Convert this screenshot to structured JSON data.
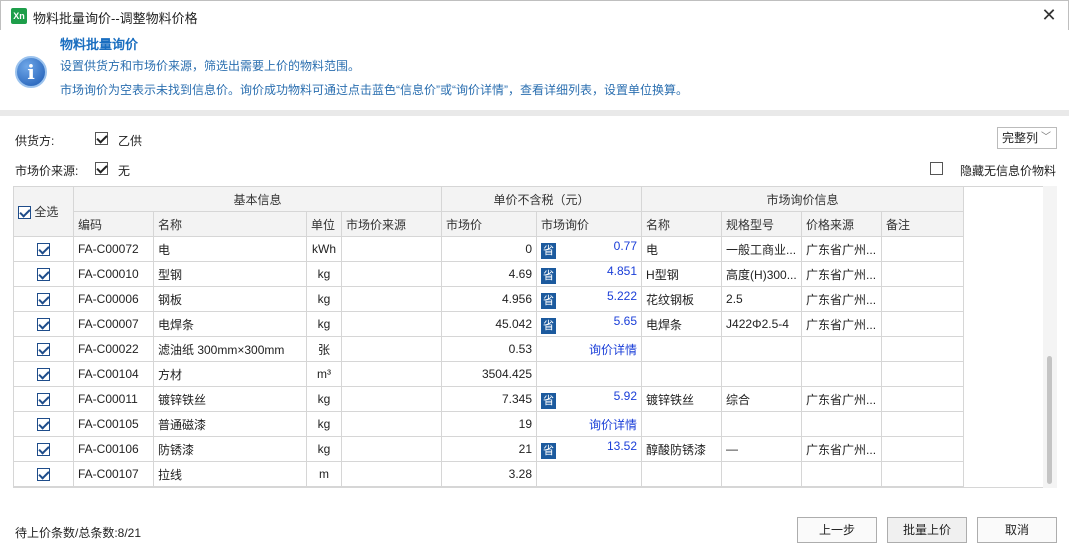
{
  "window": {
    "title": "物料批量询价--调整物料价格"
  },
  "info": {
    "title": "物料批量询价",
    "line1": "设置供货方和市场价来源，筛选出需要上价的物料范围。",
    "line2": "市场询价为空表示未找到信息价。询价成功物料可通过点击蓝色“信息价”或“询价详情”，查看详细列表，设置单位换算。"
  },
  "filters": {
    "supplier_label": "供货方:",
    "supplier_value": "乙供",
    "source_label": "市场价来源:",
    "source_value": "无",
    "column_mode": "完整列",
    "hide_label": "隐藏无信息价物料"
  },
  "table": {
    "select_all": "全选",
    "groups": {
      "basic": "基本信息",
      "price": "单价不含税（元）",
      "market": "市场询价信息"
    },
    "columns": {
      "code": "编码",
      "name": "名称",
      "unit": "单位",
      "source": "市场价来源",
      "market_price": "市场价",
      "inquiry_price": "市场询价",
      "m_name": "名称",
      "spec": "规格型号",
      "price_source": "价格来源",
      "note": "备注"
    },
    "badge": "省",
    "rows": [
      {
        "code": "FA-C00072",
        "name": "电",
        "unit": "kWh",
        "market_price": "0",
        "inquiry": "0.77",
        "m_name": "电",
        "spec": "一般工商业...",
        "source": "广东省广州..."
      },
      {
        "code": "FA-C00010",
        "name": "型钢",
        "unit": "kg",
        "market_price": "4.69",
        "inquiry": "4.851",
        "m_name": "H型钢",
        "spec": "高度(H)300...",
        "source": "广东省广州..."
      },
      {
        "code": "FA-C00006",
        "name": "钢板",
        "unit": "kg",
        "market_price": "4.956",
        "inquiry": "5.222",
        "m_name": "花纹钢板",
        "spec": "2.5",
        "source": "广东省广州..."
      },
      {
        "code": "FA-C00007",
        "name": "电焊条",
        "unit": "kg",
        "market_price": "45.042",
        "inquiry": "5.65",
        "m_name": "电焊条",
        "spec": "J422Φ2.5-4",
        "source": "广东省广州..."
      },
      {
        "code": "FA-C00022",
        "name": "滤油纸 300mm×300mm",
        "unit": "张",
        "market_price": "0.53",
        "link": "询价详情"
      },
      {
        "code": "FA-C00104",
        "name": "方材",
        "unit": "m³",
        "market_price": "3504.425"
      },
      {
        "code": "FA-C00011",
        "name": "镀锌铁丝",
        "unit": "kg",
        "market_price": "7.345",
        "inquiry": "5.92",
        "m_name": "镀锌铁丝",
        "spec": "综合",
        "source": "广东省广州..."
      },
      {
        "code": "FA-C00105",
        "name": "普通磁漆",
        "unit": "kg",
        "market_price": "19",
        "link": "询价详情"
      },
      {
        "code": "FA-C00106",
        "name": "防锈漆",
        "unit": "kg",
        "market_price": "21",
        "inquiry": "13.52",
        "m_name": "醇酸防锈漆",
        "spec": "—",
        "source": "广东省广州..."
      },
      {
        "code": "FA-C00107",
        "name": "拉线",
        "unit": "m",
        "market_price": "3.28"
      }
    ]
  },
  "status": "待上价条数/总条数:8/21",
  "buttons": {
    "prev": "上一步",
    "batch": "批量上价",
    "cancel": "取消"
  }
}
